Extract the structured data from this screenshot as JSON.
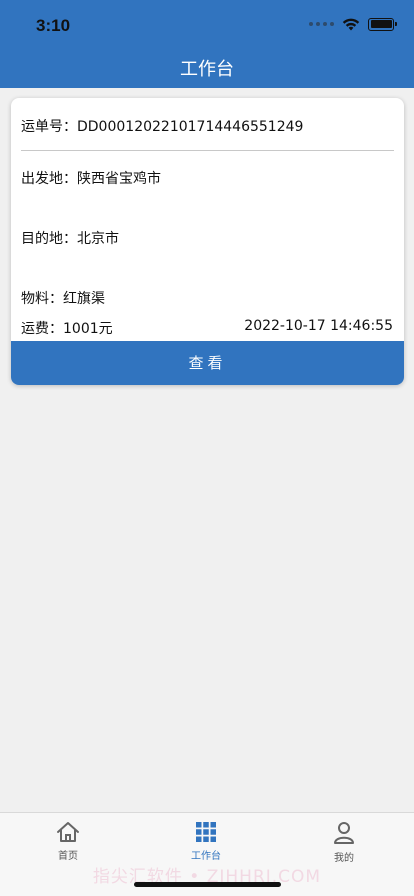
{
  "status_bar": {
    "time": "3:10"
  },
  "header": {
    "title": "工作台"
  },
  "order_card": {
    "waybill_label": "运单号：",
    "waybill_value": "DD00012022101714446551249",
    "origin_label": "出发地：",
    "origin_value": "陕西省宝鸡市",
    "destination_label": "目的地：",
    "destination_value": "北京市",
    "material_label": "物料：",
    "material_value": "红旗渠",
    "freight_label": "运费：",
    "freight_value": "1001元",
    "datetime": "2022-10-17  14:46:55",
    "view_button": "查看"
  },
  "tabbar": {
    "tabs": [
      {
        "label": "首页",
        "icon": "home-icon"
      },
      {
        "label": "工作台",
        "icon": "grid-icon"
      },
      {
        "label": "我的",
        "icon": "person-icon"
      }
    ],
    "active_tab": "工作台"
  },
  "watermark": "指尖汇软件 • ZJHHRJ.COM",
  "colors": {
    "accent": "#3174bf",
    "background": "#f0f0f0"
  }
}
